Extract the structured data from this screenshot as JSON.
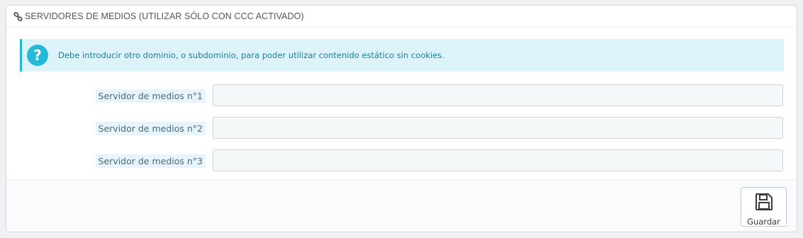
{
  "panel": {
    "heading_icon": "link-icon",
    "title": "SERVIDORES DE MEDIOS (UTILIZAR SÓLO CON CCC ACTIVADO)"
  },
  "alert": {
    "icon": "question-circle-icon",
    "message": "Debe introducir otro dominio, o subdominio, para poder utilizar contenido estático sin cookies."
  },
  "fields": [
    {
      "label": "Servidor de medios n°1",
      "value": "",
      "placeholder": ""
    },
    {
      "label": "Servidor de medios n°2",
      "value": "",
      "placeholder": ""
    },
    {
      "label": "Servidor de medios n°3",
      "value": "",
      "placeholder": ""
    }
  ],
  "footer": {
    "save_icon": "floppy-disk-icon",
    "save_label": "Guardar"
  },
  "colors": {
    "accent": "#25b9d7",
    "alert_bg": "#dcf4f9",
    "alert_text": "#1e7d97"
  }
}
